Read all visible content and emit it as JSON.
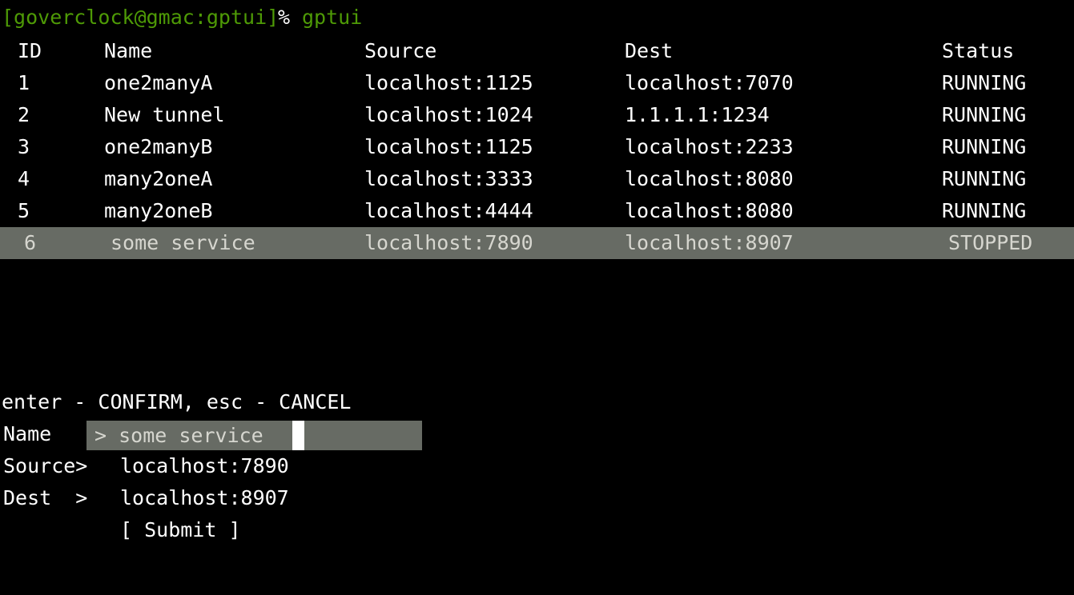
{
  "terminal": {
    "background": "#000000",
    "foreground": "#ffffff",
    "prompt_color": "#4e9a06",
    "selection_color": "#676b64",
    "cursor_color": "#ffffff"
  },
  "prompt": {
    "host": "[goverclock@gmac:gptui]",
    "sigil": "%",
    "command": "gptui"
  },
  "table": {
    "headers": {
      "id": "ID",
      "name": "Name",
      "source": "Source",
      "dest": "Dest",
      "status": "Status"
    },
    "rows": [
      {
        "id": "1",
        "name": "one2manyA",
        "source": "localhost:1125",
        "dest": "localhost:7070",
        "status": "RUNNING",
        "selected": false
      },
      {
        "id": "2",
        "name": "New tunnel",
        "source": "localhost:1024",
        "dest": "1.1.1.1:1234",
        "status": "RUNNING",
        "selected": false
      },
      {
        "id": "3",
        "name": "one2manyB",
        "source": "localhost:1125",
        "dest": "localhost:2233",
        "status": "RUNNING",
        "selected": false
      },
      {
        "id": "4",
        "name": "many2oneA",
        "source": "localhost:3333",
        "dest": "localhost:8080",
        "status": "RUNNING",
        "selected": false
      },
      {
        "id": "5",
        "name": "many2oneB",
        "source": "localhost:4444",
        "dest": "localhost:8080",
        "status": "RUNNING",
        "selected": false
      },
      {
        "id": "6",
        "name": "some service",
        "source": "localhost:7890",
        "dest": "localhost:8907",
        "status": "STOPPED",
        "selected": true
      }
    ]
  },
  "form": {
    "hint": "enter - CONFIRM, esc - CANCEL",
    "name": {
      "label": "Name",
      "caret": "> ",
      "value": "some service",
      "focused": true
    },
    "source": {
      "label": "Source>",
      "value": "localhost:7890",
      "focused": false
    },
    "dest": {
      "label": "Dest  >",
      "value": "localhost:8907",
      "focused": false
    },
    "submit": {
      "label": "[ Submit ]"
    }
  }
}
